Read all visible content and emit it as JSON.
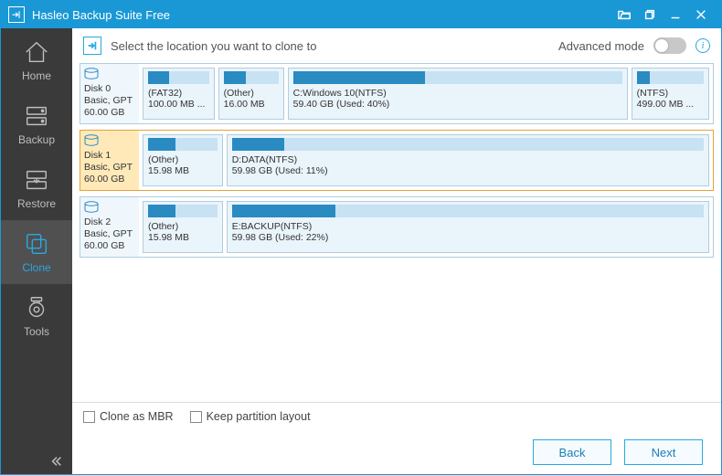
{
  "app": {
    "title": "Hasleo Backup Suite Free"
  },
  "sidebar": {
    "items": [
      {
        "label": "Home"
      },
      {
        "label": "Backup"
      },
      {
        "label": "Restore"
      },
      {
        "label": "Clone"
      },
      {
        "label": "Tools"
      }
    ]
  },
  "topbar": {
    "instruction": "Select the location you want to clone to",
    "advanced_label": "Advanced mode"
  },
  "disks": [
    {
      "name": "Disk 0",
      "type": "Basic, GPT",
      "size": "60.00 GB",
      "selected": false,
      "partitions": [
        {
          "label": "(FAT32)",
          "sub": "100.00 MB ...",
          "fill": 35,
          "flex": 10
        },
        {
          "label": "(Other)",
          "sub": "16.00 MB",
          "fill": 40,
          "flex": 9
        },
        {
          "label": "C:Windows 10(NTFS)",
          "sub": "59.40 GB (Used: 40%)",
          "fill": 40,
          "flex": 54
        },
        {
          "label": "(NTFS)",
          "sub": "499.00 MB ...",
          "fill": 20,
          "flex": 11
        }
      ]
    },
    {
      "name": "Disk 1",
      "type": "Basic, GPT",
      "size": "60.00 GB",
      "selected": true,
      "partitions": [
        {
          "label": "(Other)",
          "sub": "15.98 MB",
          "fill": 40,
          "flex": 11
        },
        {
          "label": "D:DATA(NTFS)",
          "sub": "59.98 GB (Used: 11%)",
          "fill": 11,
          "flex": 75
        }
      ]
    },
    {
      "name": "Disk 2",
      "type": "Basic, GPT",
      "size": "60.00 GB",
      "selected": false,
      "partitions": [
        {
          "label": "(Other)",
          "sub": "15.98 MB",
          "fill": 40,
          "flex": 11
        },
        {
          "label": "E:BACKUP(NTFS)",
          "sub": "59.98 GB (Used: 22%)",
          "fill": 22,
          "flex": 75
        }
      ]
    }
  ],
  "options": {
    "clone_as_mbr": "Clone as MBR",
    "keep_layout": "Keep partition layout"
  },
  "footer": {
    "back": "Back",
    "next": "Next"
  }
}
